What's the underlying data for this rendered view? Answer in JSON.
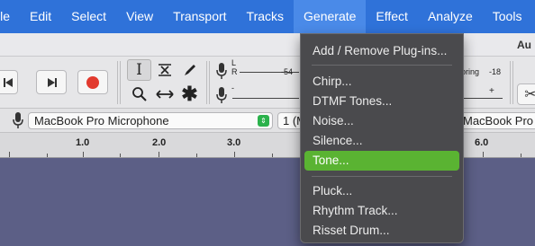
{
  "menubar": {
    "items": [
      {
        "label": "ile"
      },
      {
        "label": "Edit"
      },
      {
        "label": "Select"
      },
      {
        "label": "View"
      },
      {
        "label": "Transport"
      },
      {
        "label": "Tracks"
      },
      {
        "label": "Generate"
      },
      {
        "label": "Effect"
      },
      {
        "label": "Analyze"
      },
      {
        "label": "Tools"
      }
    ]
  },
  "window": {
    "title_partial": "Au"
  },
  "meters": {
    "left_label": "L",
    "right_label": "R",
    "play_value": "-54",
    "rec_label": "oring",
    "rec_value": "-18",
    "plus": "+"
  },
  "device": {
    "input": "MacBook Pro Microphone",
    "channels": "1 (M",
    "output": "MacBook Pro"
  },
  "ruler": {
    "labels": [
      "1.0",
      "2.0",
      "3.0",
      "6.0"
    ]
  },
  "generate_menu": {
    "items": [
      {
        "label": "Add / Remove Plug-ins..."
      },
      {
        "label": "Chirp..."
      },
      {
        "label": "DTMF Tones..."
      },
      {
        "label": "Noise..."
      },
      {
        "label": "Silence..."
      },
      {
        "label": "Tone...",
        "highlighted": true
      },
      {
        "label": "Pluck..."
      },
      {
        "label": "Rhythm Track..."
      },
      {
        "label": "Risset Drum..."
      }
    ]
  },
  "colors": {
    "menubar": "#2f72d9",
    "highlight": "#5ab332",
    "record": "#e23a2e",
    "track_bg": "#5c5f86"
  },
  "icons": [
    "skip-start-icon",
    "skip-end-icon",
    "record-icon",
    "selection-tool-icon",
    "envelope-tool-icon",
    "draw-tool-icon",
    "zoom-tool-icon",
    "timeshift-tool-icon",
    "multi-tool-icon",
    "microphone-icon",
    "speaker-icon",
    "scissors-icon"
  ]
}
